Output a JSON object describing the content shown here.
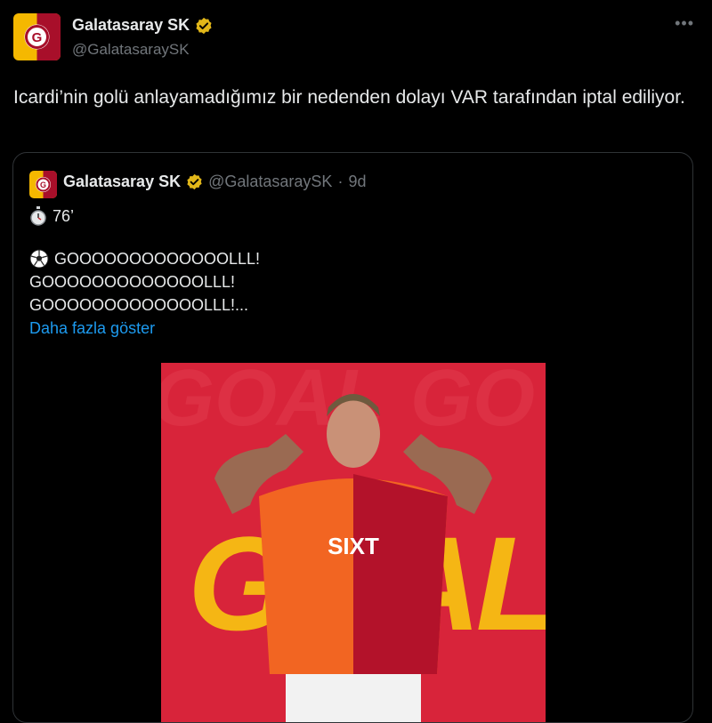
{
  "tweet": {
    "author_name": "Galatasaray SK",
    "author_handle": "@GalatasaraySK",
    "more_icon": "ellipsis-icon",
    "text": "Icardi’nin golü anlayamadığımız bir nedenden dolayı VAR tarafından iptal ediliyor."
  },
  "quoted_tweet": {
    "author_name": "Galatasaray SK",
    "author_handle": "@GalatasaraySK",
    "separator": "·",
    "age": "9d",
    "timer_line": "76’",
    "goal_lines": [
      "GOOOOOOOOOOOOOLLL!",
      "GOOOOOOOOOOOOOLLL!",
      "GOOOOOOOOOOOOOLLL!..."
    ],
    "show_more": "Daha fazla göster",
    "media": {
      "sponsor_text": "SIXT",
      "colors": {
        "background": "#d8243a",
        "jersey_orange": "#f26522",
        "jersey_red": "#b3122a",
        "goal_yellow": "#f5b614"
      }
    }
  },
  "colors": {
    "verified_badge": "#e2b719",
    "link": "#1d9bf0",
    "muted": "#71767b"
  }
}
